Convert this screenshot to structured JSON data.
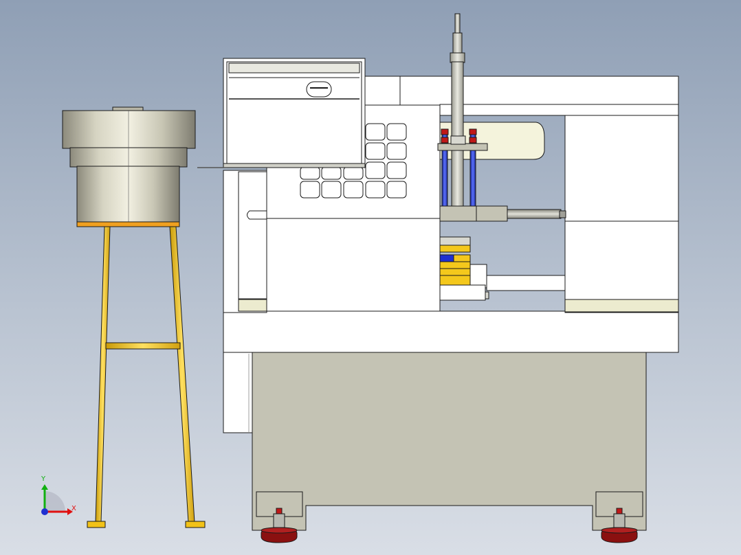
{
  "viewport": {
    "background_top": "#8f9fb5",
    "background_bottom": "#d9dee6",
    "view": "front"
  },
  "triad": {
    "x_label": "X",
    "y_label": "Y",
    "x_color": "#e01010",
    "y_color": "#10b010",
    "z_color": "#2030d0"
  },
  "model": {
    "components": [
      "vibratory-bowl-feeder",
      "feeder-stand",
      "machine-base",
      "machine-enclosure",
      "sliding-door",
      "control-keypad",
      "vertical-cylinder",
      "guide-rods",
      "horizontal-cylinder",
      "clamp-block",
      "leveling-feet"
    ],
    "colors": {
      "stand": "#f2c218",
      "bowl_metal": "#c9c6b4",
      "base": "#c4c3b4",
      "enclosure": "#ffffff",
      "accent_cream": "#ecebcf",
      "rod_blue": "#2838c8",
      "cap_red": "#c01818",
      "foot_red": "#8a1010",
      "clamp_yellow": "#f4c81c",
      "outline": "#1a1a1a"
    },
    "keypad_keys": 15
  }
}
